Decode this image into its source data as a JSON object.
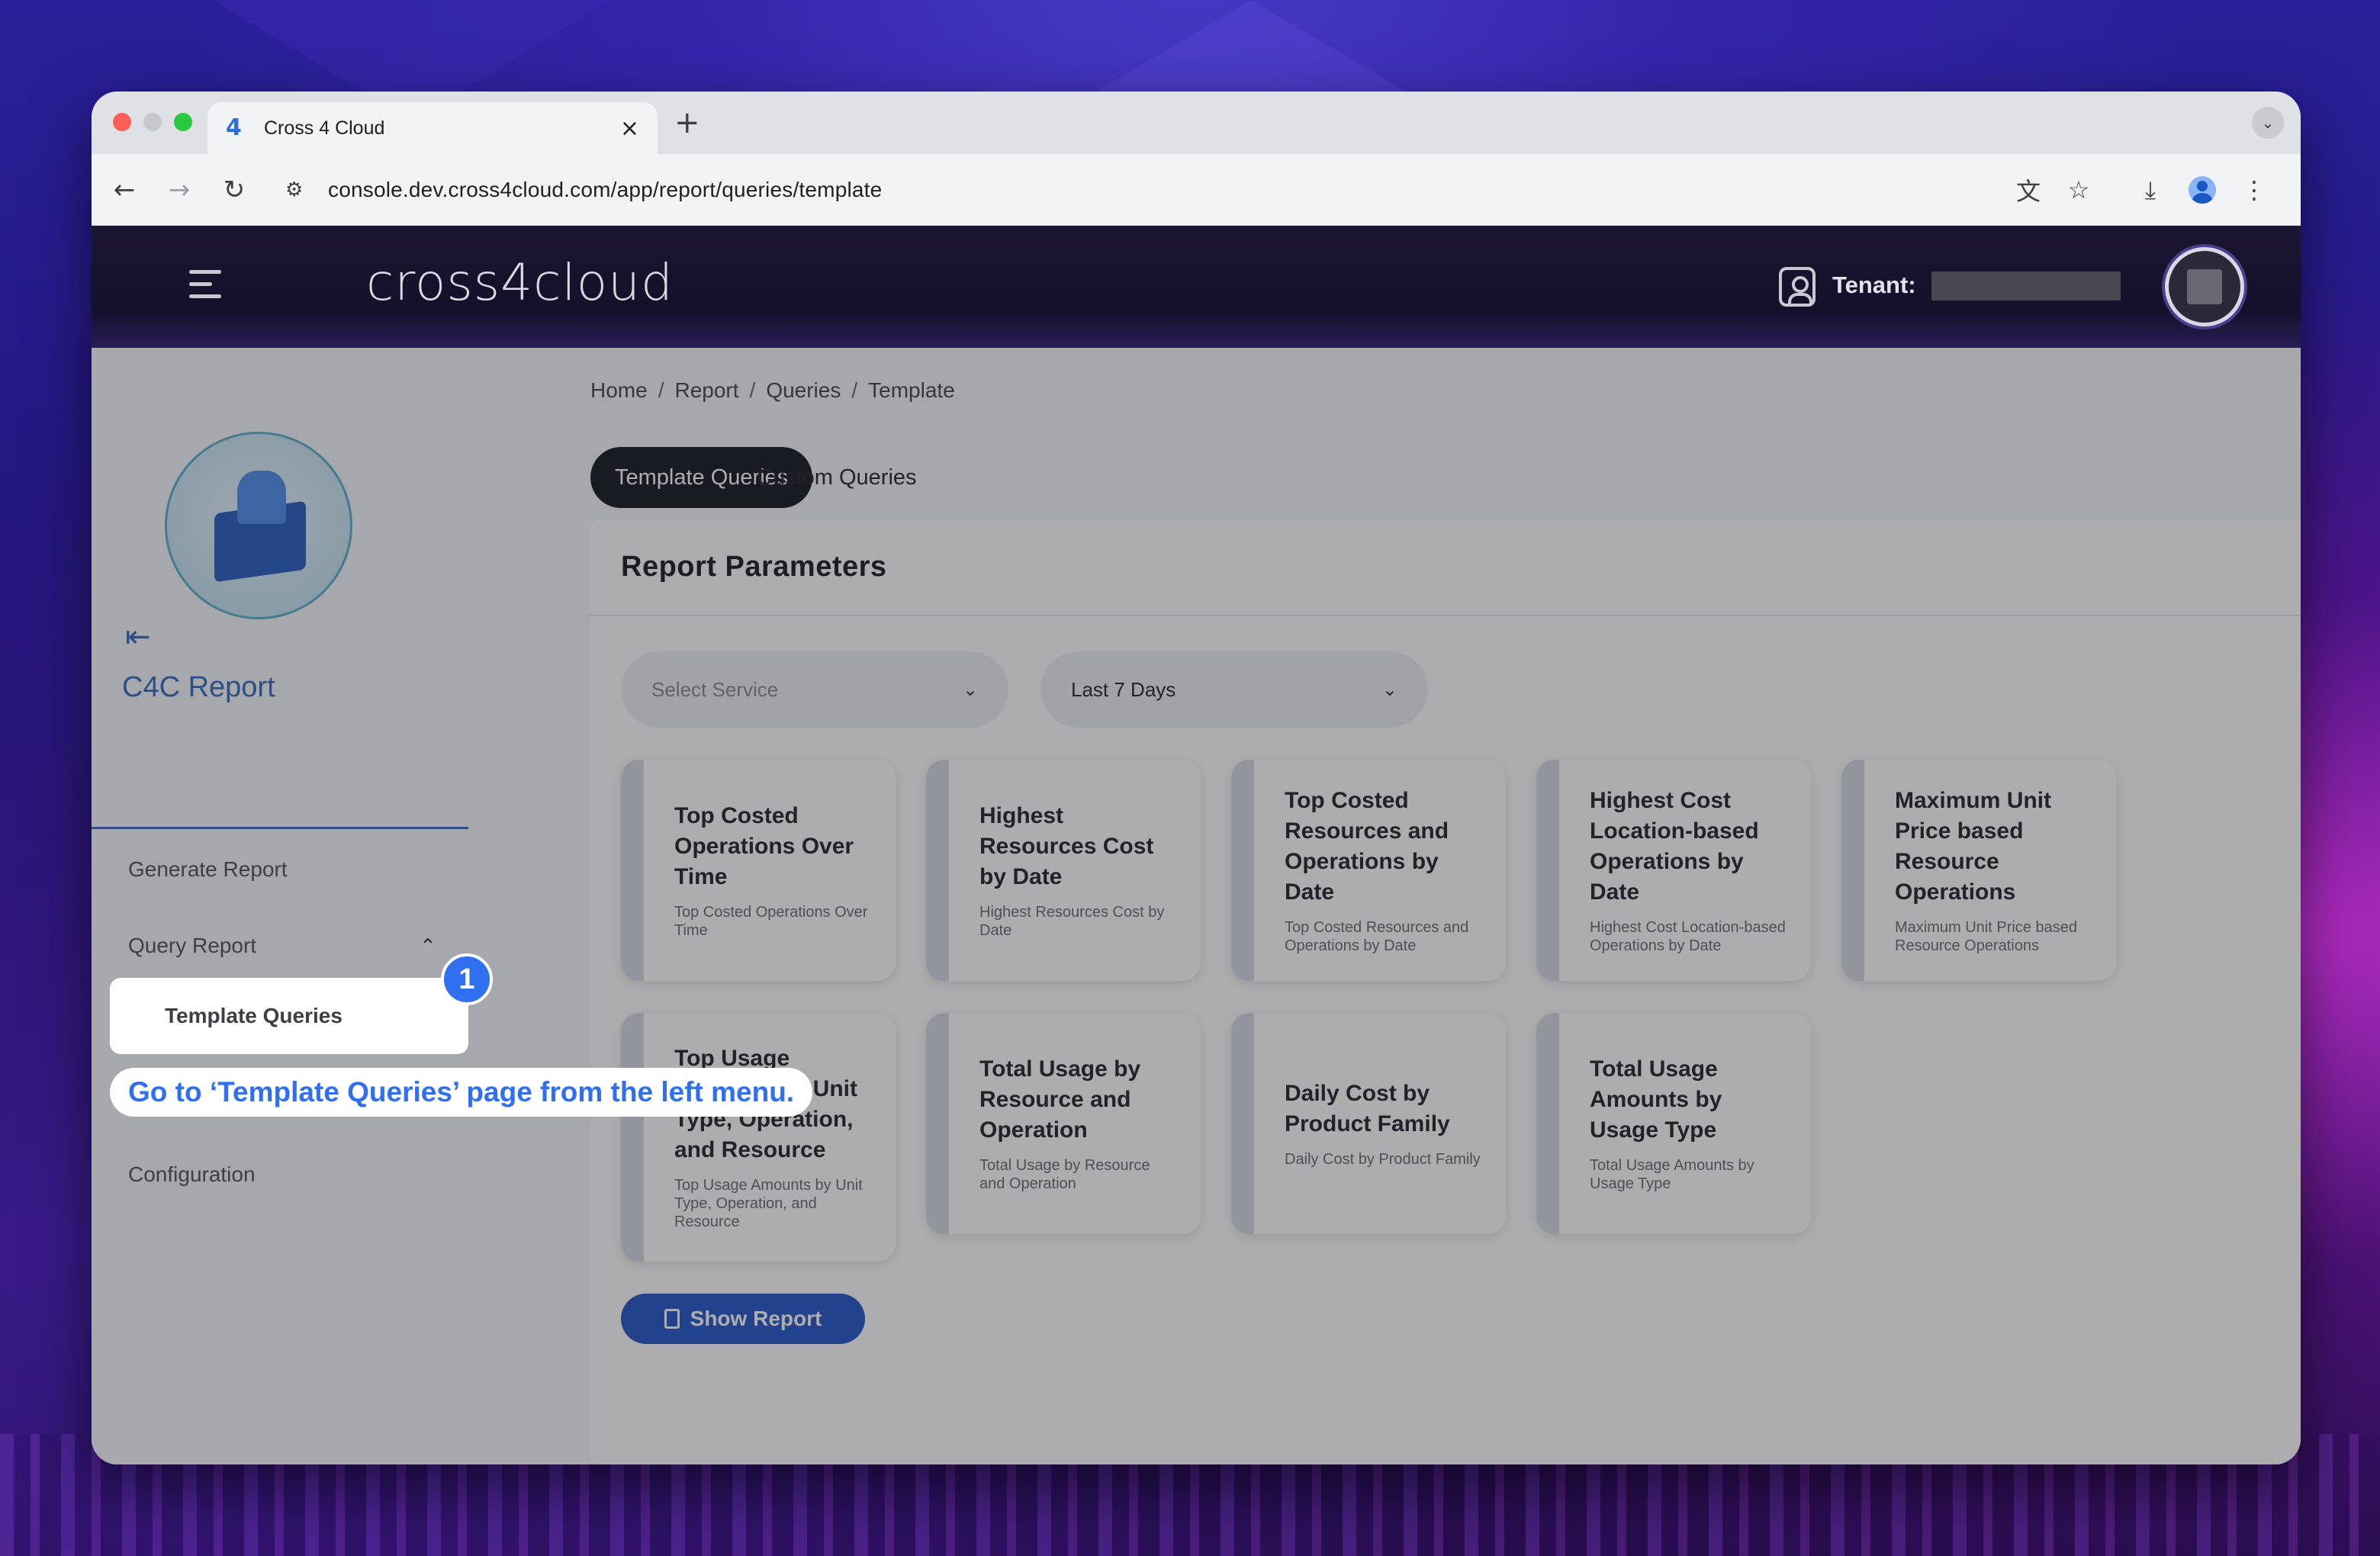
{
  "browser": {
    "tab_title": "Cross 4 Cloud",
    "url": "console.dev.cross4cloud.com/app/report/queries/template"
  },
  "header": {
    "brand": "cross4cloud",
    "tenant_label": "Tenant:"
  },
  "sidebar": {
    "title": "C4C Report",
    "items": [
      {
        "label": "Generate Report"
      },
      {
        "label": "Query Report"
      },
      {
        "label": "Template Queries"
      },
      {
        "label": "Configuration"
      }
    ]
  },
  "breadcrumb": [
    "Home",
    "Report",
    "Queries",
    "Template"
  ],
  "tabs": [
    {
      "label": "Template Queries",
      "active": true
    },
    {
      "label": "Custom Queries",
      "active": false
    }
  ],
  "panel": {
    "title": "Report Parameters",
    "service_select": {
      "placeholder": "Select Service"
    },
    "range_select": {
      "value": "Last 7 Days"
    },
    "cards": [
      {
        "title": "Top Costed Operations Over Time",
        "desc": "Top Costed Operations Over Time"
      },
      {
        "title": "Highest Resources Cost by Date",
        "desc": "Highest Resources Cost by Date"
      },
      {
        "title": "Top Costed Resources and Operations by Date",
        "desc": "Top Costed Resources and Operations by Date"
      },
      {
        "title": "Highest Cost Location-based Operations by Date",
        "desc": "Highest Cost Location-based Operations by Date"
      },
      {
        "title": "Maximum Unit Price based Resource Operations",
        "desc": "Maximum Unit Price based Resource Operations"
      },
      {
        "title": "Top Usage Amounts by Unit Type, Operation, and Resource",
        "desc": "Top Usage Amounts by Unit Type, Operation, and Resource"
      },
      {
        "title": "Total Usage by Resource and Operation",
        "desc": "Total Usage by Resource and Operation"
      },
      {
        "title": "Daily Cost by Product Family",
        "desc": "Daily Cost by Product Family"
      },
      {
        "title": "Total Usage Amounts by Usage Type",
        "desc": "Total Usage Amounts by Usage Type"
      }
    ],
    "show_report_label": "Show Report"
  },
  "tutorial": {
    "step_number": "1",
    "callout": "Go to ‘Template Queries’ page from the left menu."
  }
}
